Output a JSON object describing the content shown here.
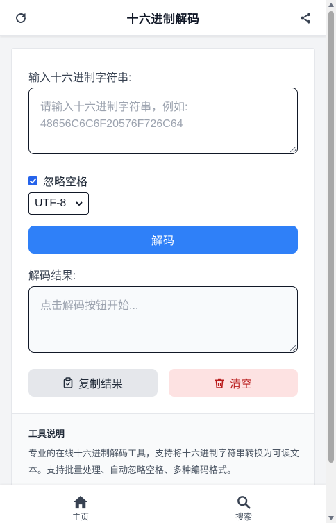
{
  "header": {
    "title": "十六进制解码",
    "refresh_icon": "refresh-icon",
    "share_icon": "share-icon"
  },
  "form": {
    "input_label": "输入十六进制字符串:",
    "input_placeholder": "请输入十六进制字符串，例如: 48656C6C6F20576F726C64",
    "ignore_spaces_label": "忽略空格",
    "ignore_spaces_checked": true,
    "encoding_selected": "UTF-8",
    "decode_button": "解码",
    "result_label": "解码结果:",
    "result_placeholder": "点击解码按钮开始...",
    "copy_button": "复制结果",
    "clear_button": "清空"
  },
  "info": {
    "title": "工具说明",
    "description": "专业的在线十六进制解码工具，支持将十六进制字符串转换为可读文本。支持批量处理、自动忽略空格、多种编码格式。"
  },
  "bottom_nav": {
    "home_label": "主页",
    "search_label": "搜索"
  },
  "colors": {
    "primary": "#2f80f8",
    "danger_bg": "#fde2e2",
    "danger_text": "#b91c1c",
    "neutral_btn": "#e5e7eb"
  }
}
